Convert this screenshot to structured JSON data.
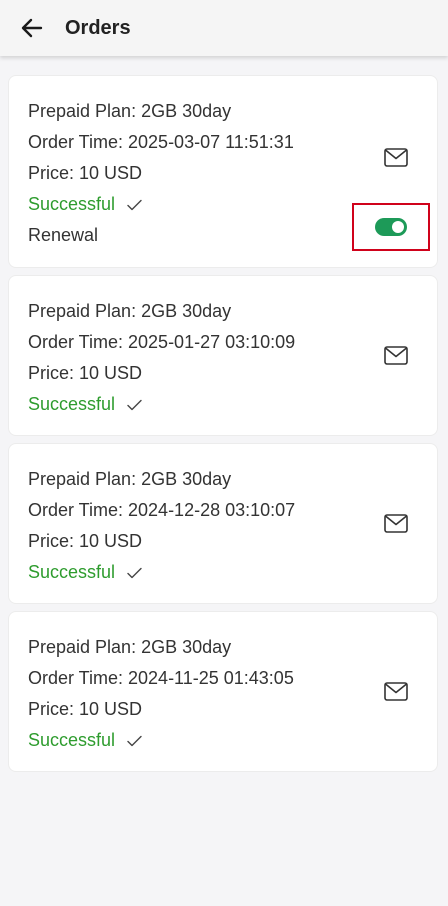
{
  "header": {
    "title": "Orders",
    "back_icon": "arrow-left-icon"
  },
  "orders": [
    {
      "plan": "Prepaid Plan: 2GB 30day",
      "order_time": "Order Time: 2025-03-07 11:51:31",
      "price": "Price: 10 USD",
      "status": "Successful",
      "renewal_label": "Renewal",
      "renewal_on": true
    },
    {
      "plan": "Prepaid Plan: 2GB 30day",
      "order_time": "Order Time: 2025-01-27 03:10:09",
      "price": "Price: 10 USD",
      "status": "Successful"
    },
    {
      "plan": "Prepaid Plan: 2GB 30day",
      "order_time": "Order Time: 2024-12-28 03:10:07",
      "price": "Price: 10 USD",
      "status": "Successful"
    },
    {
      "plan": "Prepaid Plan: 2GB 30day",
      "order_time": "Order Time: 2024-11-25 01:43:05",
      "price": "Price: 10 USD",
      "status": "Successful"
    }
  ],
  "icons": {
    "check": "check-icon",
    "mail": "mail-icon"
  },
  "colors": {
    "success": "#2e9c2e",
    "toggle_on": "#1d9a58",
    "highlight_frame": "#d0021b",
    "page_background": "#f5f5f7"
  }
}
